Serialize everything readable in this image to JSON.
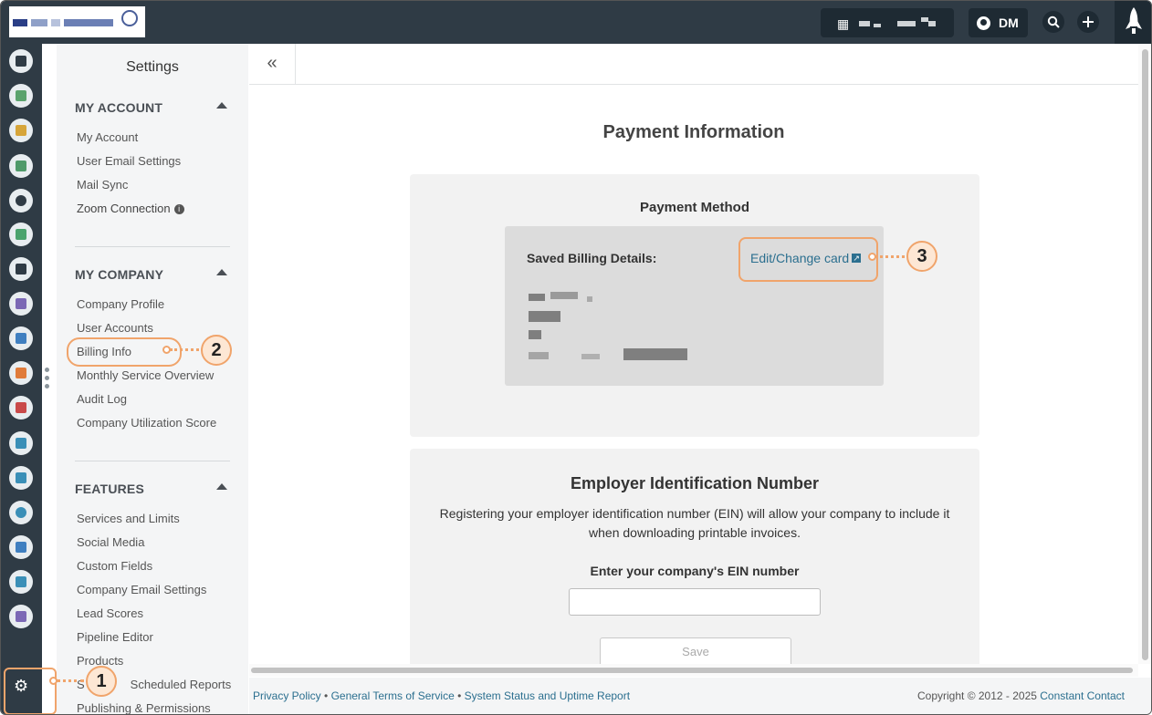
{
  "header": {
    "org_icon": "building-icon",
    "user_initials": "DM",
    "search_icon": "search-icon",
    "add_icon": "plus-icon",
    "launch_icon": "rocket-icon"
  },
  "rail": {
    "icons": [
      "contacts-icon",
      "email-icon",
      "tasks-icon",
      "map-icon",
      "branch-icon",
      "list-icon",
      "megaphone-icon",
      "chat-icon",
      "thumbs-up-icon",
      "images-icon",
      "calendar-icon",
      "handshake-icon",
      "growth-chart-icon",
      "headset-icon",
      "user-star-icon",
      "bar-chart-icon",
      "plug-icon"
    ],
    "settings_icon": "gear-icon"
  },
  "settings_nav": {
    "title": "Settings",
    "sections": [
      {
        "title": "MY ACCOUNT",
        "items": [
          "My Account",
          "User Email Settings",
          "Mail Sync",
          "Zoom Connection"
        ]
      },
      {
        "title": "MY COMPANY",
        "items": [
          "Company Profile",
          "User Accounts",
          "Billing Info",
          "Monthly Service Overview",
          "Audit Log",
          "Company Utilization Score"
        ]
      },
      {
        "title": "FEATURES",
        "items": [
          "Services and Limits",
          "Social Media",
          "Custom Fields",
          "Company Email Settings",
          "Lead Scores",
          "Pipeline Editor",
          "Products",
          "S",
          "Scheduled Reports",
          "Publishing & Permissions"
        ]
      }
    ]
  },
  "main": {
    "collapse_icon": "«",
    "page_title": "Payment Information",
    "payment": {
      "title": "Payment Method",
      "saved_label": "Saved Billing Details:",
      "edit_link": "Edit/Change card"
    },
    "ein": {
      "title": "Employer Identification Number",
      "description_line1": "Registering your employer identification number (EIN) will allow your company to include it",
      "description_line2": "when downloading printable invoices.",
      "field_label": "Enter your company's EIN number",
      "field_value": "",
      "save_label": "Save"
    }
  },
  "footer": {
    "privacy": "Privacy Policy",
    "terms": "General Terms of Service",
    "status": "System Status and Uptime Report",
    "separator": "•",
    "copyright_prefix": "Copyright © 2012 - 2025",
    "copyright_link": "Constant Contact"
  },
  "callouts": [
    "1",
    "2",
    "3"
  ],
  "colors": {
    "accent": "#f0a46b",
    "topbar": "#2f3b45",
    "link": "#2b6f8f"
  }
}
